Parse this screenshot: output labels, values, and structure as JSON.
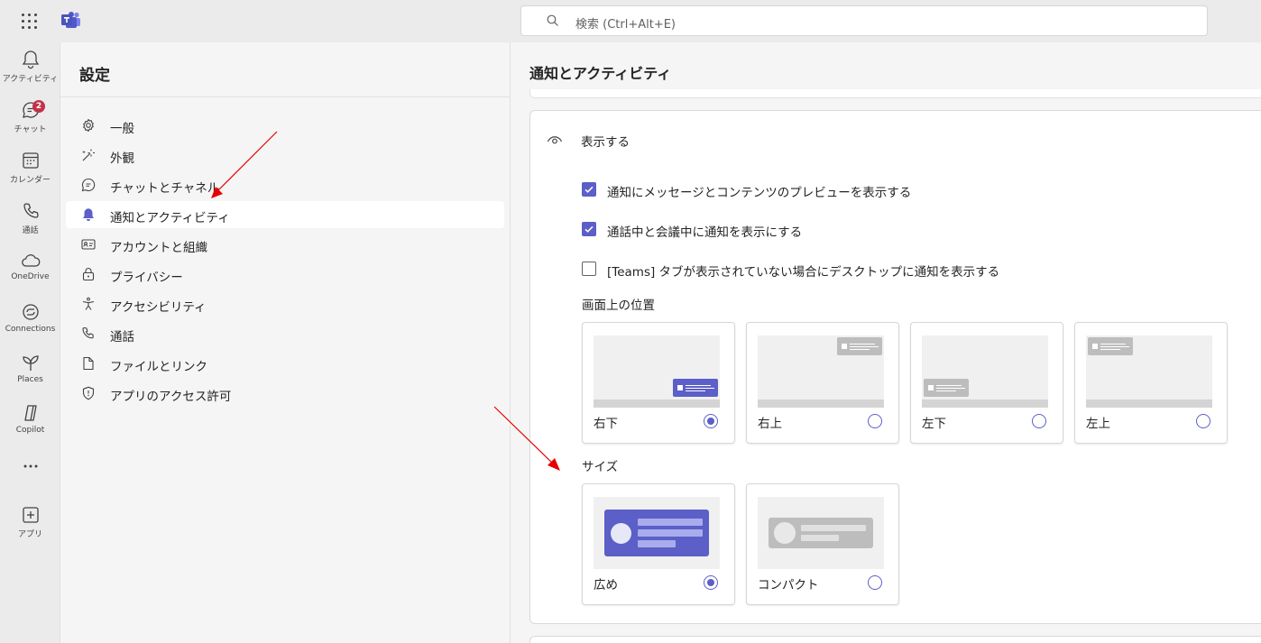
{
  "search": {
    "placeholder": "検索 (Ctrl+Alt+E)"
  },
  "rail": {
    "items": [
      {
        "label": "アクティビティ",
        "icon": "bell-icon"
      },
      {
        "label": "チャット",
        "icon": "chat-icon",
        "badge": "2"
      },
      {
        "label": "カレンダー",
        "icon": "calendar-icon"
      },
      {
        "label": "通話",
        "icon": "phone-icon"
      },
      {
        "label": "OneDrive",
        "icon": "cloud-icon"
      },
      {
        "label": "Connections",
        "icon": "connections-icon"
      },
      {
        "label": "Places",
        "icon": "places-icon"
      },
      {
        "label": "Copilot",
        "icon": "copilot-icon"
      },
      {
        "label": "アプリ",
        "icon": "add-apps-icon"
      }
    ]
  },
  "settings": {
    "title": "設定",
    "items": [
      {
        "label": "一般",
        "icon": "gear-icon"
      },
      {
        "label": "外観",
        "icon": "magic-wand-icon"
      },
      {
        "label": "チャットとチャネル",
        "icon": "chat-icon"
      },
      {
        "label": "通知とアクティビティ",
        "icon": "bell-icon",
        "active": true
      },
      {
        "label": "アカウントと組織",
        "icon": "id-card-icon"
      },
      {
        "label": "プライバシー",
        "icon": "lock-icon"
      },
      {
        "label": "アクセシビリティ",
        "icon": "accessibility-icon"
      },
      {
        "label": "通話",
        "icon": "phone-icon"
      },
      {
        "label": "ファイルとリンク",
        "icon": "document-icon"
      },
      {
        "label": "アプリのアクセス許可",
        "icon": "shield-icon"
      }
    ]
  },
  "main": {
    "title": "通知とアクティビティ",
    "section": {
      "title": "表示する",
      "checkboxes": [
        {
          "label": "通知にメッセージとコンテンツのプレビューを表示する",
          "checked": true
        },
        {
          "label": "通話中と会議中に通知を表示にする",
          "checked": true
        },
        {
          "label": "[Teams] タブが表示されていない場合にデスクトップに通知を表示する",
          "checked": false
        }
      ],
      "position": {
        "title": "画面上の位置",
        "options": [
          {
            "label": "右下",
            "selected": true
          },
          {
            "label": "右上",
            "selected": false
          },
          {
            "label": "左下",
            "selected": false
          },
          {
            "label": "左上",
            "selected": false
          }
        ]
      },
      "size": {
        "title": "サイズ",
        "options": [
          {
            "label": "広め",
            "selected": true
          },
          {
            "label": "コンパクト",
            "selected": false
          }
        ]
      }
    }
  },
  "colors": {
    "accent": "#5b5fc7",
    "annotation_arrow": "#e60000"
  }
}
